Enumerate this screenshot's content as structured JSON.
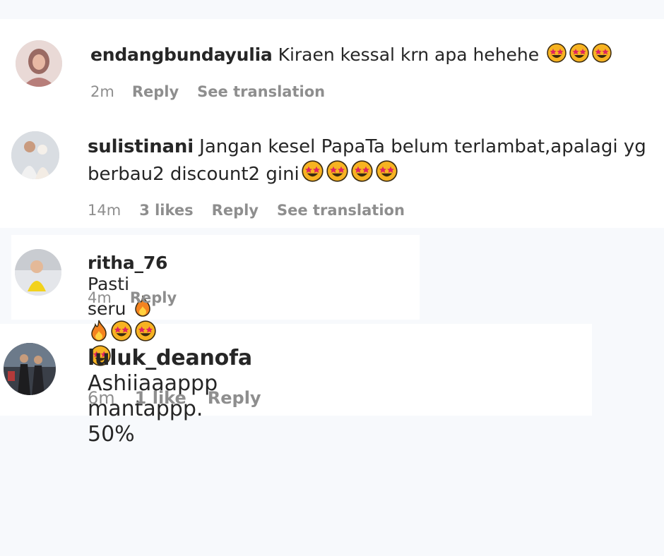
{
  "comments": [
    {
      "username": "endangbundayulia",
      "text": "Kiraen kessal krn apa hehehe",
      "emojis": [
        "star-struck-emoji",
        "star-struck-emoji",
        "star-struck-emoji"
      ],
      "time": "2m",
      "likes": "",
      "reply_label": "Reply",
      "translate_label": "See translation"
    },
    {
      "username": "sulistinani",
      "text_line1": "Jangan kesel PapaTa belum terlambat,apalagi yg",
      "text_line2": "berbau2 discount2 gini",
      "emojis": [
        "star-struck-emoji",
        "star-struck-emoji",
        "star-struck-emoji",
        "star-struck-emoji"
      ],
      "time": "14m",
      "likes": "3 likes",
      "reply_label": "Reply",
      "translate_label": "See translation"
    },
    {
      "username": "ritha_76",
      "text": "Pasti seru",
      "emojis": [
        "fire-emoji",
        "fire-emoji",
        "star-struck-emoji",
        "star-struck-emoji",
        "star-struck-emoji"
      ],
      "time": "4m",
      "likes": "",
      "reply_label": "Reply"
    },
    {
      "username": "luluk_deanofa",
      "text": "Ashiiaaappp mantappp. 50%",
      "time": "6m",
      "likes": "1 like",
      "reply_label": "Reply"
    }
  ],
  "colors": {
    "page_background": "#f7f9fc",
    "panel_background": "#ffffff",
    "primary_text": "#262626",
    "secondary_text": "#8e8e8e",
    "emoji_face": "#f7b321",
    "emoji_eyes": "#e0245e"
  }
}
